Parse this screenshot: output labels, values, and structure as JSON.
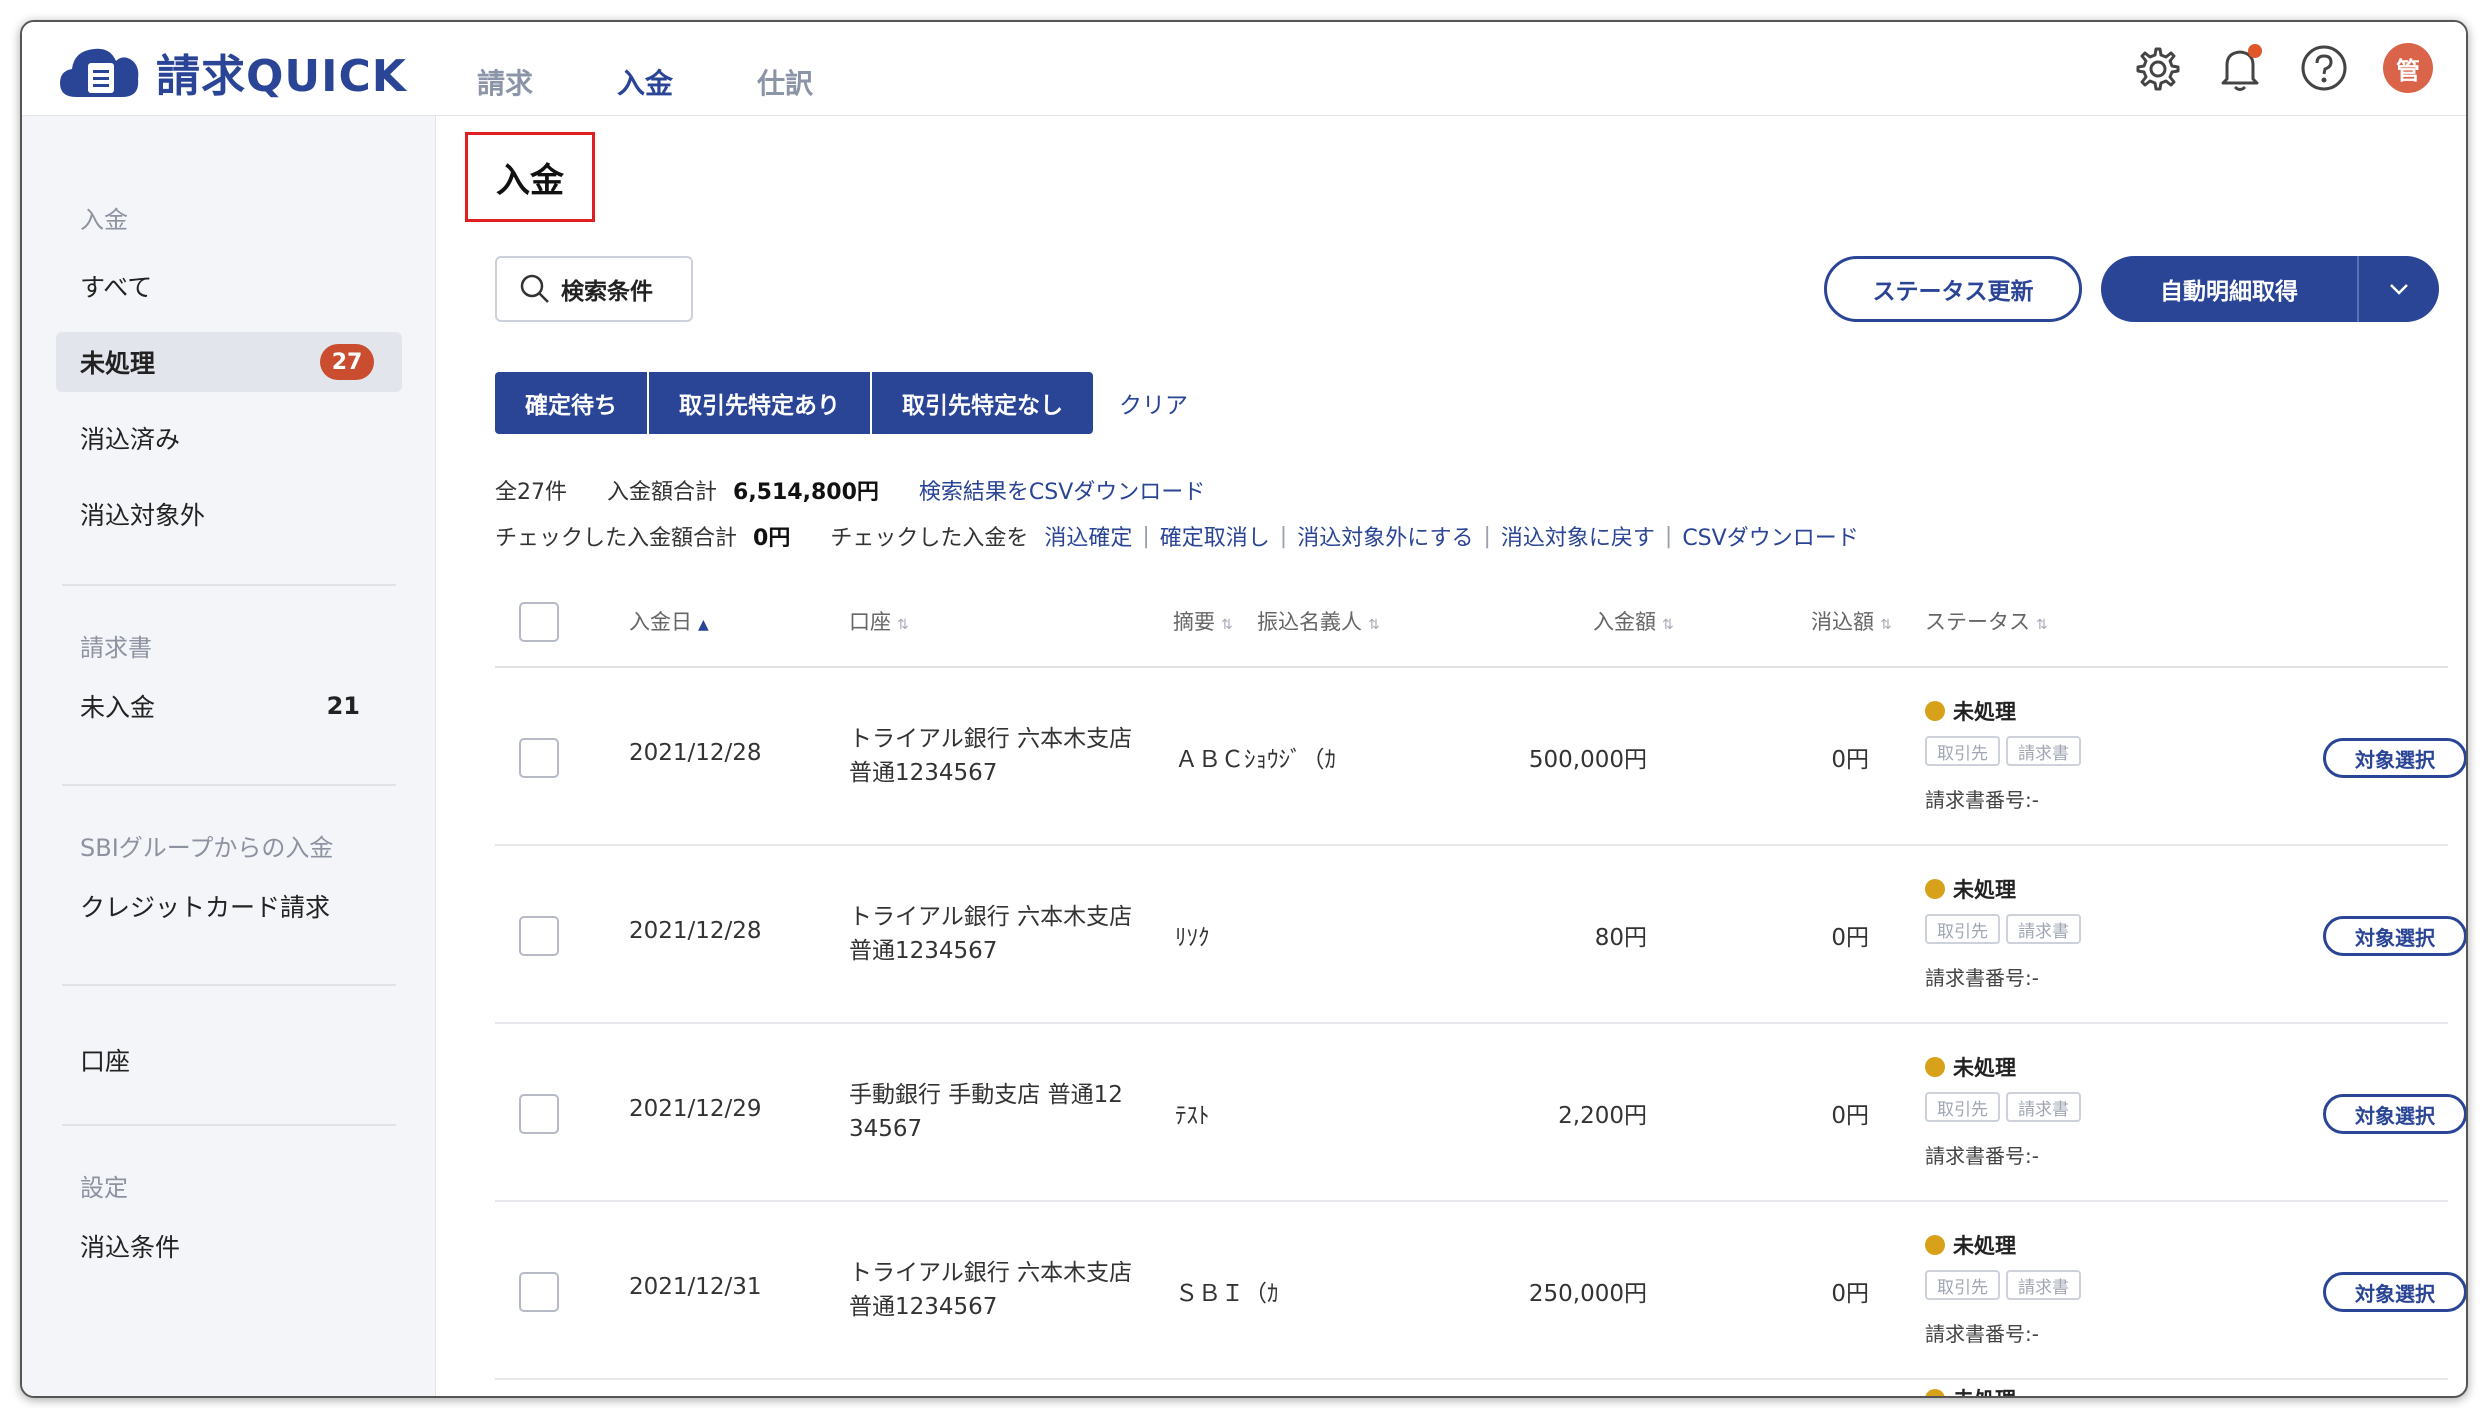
{
  "app": {
    "name": "請求QUICK",
    "avatar_initial": "管",
    "colors": {
      "primary": "#2a4496",
      "badge": "#c94d2e",
      "status_dot": "#d8a11a",
      "highlight_box": "#e02020"
    },
    "icons": [
      "logo-icon",
      "gear-icon",
      "bell-icon",
      "help-icon",
      "avatar"
    ]
  },
  "nav": {
    "items": [
      "請求",
      "入金",
      "仕訳"
    ],
    "active": "入金"
  },
  "sidebar": {
    "sections": [
      {
        "title": "入金",
        "items": [
          {
            "label": "すべて"
          },
          {
            "label": "未処理",
            "badge": "27",
            "active": true
          },
          {
            "label": "消込済み"
          },
          {
            "label": "消込対象外"
          }
        ]
      },
      {
        "title": "請求書",
        "items": [
          {
            "label": "未入金",
            "count": "21"
          }
        ]
      },
      {
        "title": "SBIグループからの入金",
        "items": [
          {
            "label": "クレジットカード請求"
          }
        ]
      },
      {
        "title": "",
        "items": [
          {
            "label": "口座"
          }
        ]
      },
      {
        "title": "設定",
        "items": [
          {
            "label": "消込条件"
          }
        ]
      }
    ]
  },
  "main": {
    "title": "入金",
    "search_label": "検索条件",
    "status_update_label": "ステータス更新",
    "auto_fetch_label": "自動明細取得",
    "filters": [
      "確定待ち",
      "取引先特定あり",
      "取引先特定なし"
    ],
    "clear_label": "クリア",
    "summary": {
      "total_count": "全27件",
      "amount_label": "入金額合計",
      "amount_value": "6,514,800円",
      "csv_link": "検索結果をCSVダウンロード",
      "checked_label": "チェックした入金額合計",
      "checked_value": "0円",
      "checked_action_label": "チェックした入金を",
      "actions": [
        "消込確定",
        "確定取消し",
        "消込対象外にする",
        "消込対象に戻す",
        "CSVダウンロード"
      ]
    },
    "columns": {
      "date": "入金日",
      "account": "口座",
      "memo": "摘要",
      "payer": "振込名義人",
      "amount": "入金額",
      "cleared": "消込額",
      "status": "ステータス"
    },
    "rows": [
      {
        "date": "2021/12/28",
        "account_line1": "トライアル銀行 六本木支店",
        "account_line2": "普通1234567",
        "payer": "ＡＢＣｼｮｳｼﾞ（ｶ",
        "amount": "500,000円",
        "cleared": "0円",
        "status": "未処理",
        "tag1": "取引先",
        "tag2": "請求書",
        "invoice_no": "請求書番号:-",
        "button": "対象選択"
      },
      {
        "date": "2021/12/28",
        "account_line1": "トライアル銀行 六本木支店",
        "account_line2": "普通1234567",
        "payer": "ﾘｿｸ",
        "amount": "80円",
        "cleared": "0円",
        "status": "未処理",
        "tag1": "取引先",
        "tag2": "請求書",
        "invoice_no": "請求書番号:-",
        "button": "対象選択"
      },
      {
        "date": "2021/12/29",
        "account_line1": "手動銀行 手動支店 普通12",
        "account_line2": "34567",
        "payer": "ﾃｽﾄ",
        "amount": "2,200円",
        "cleared": "0円",
        "status": "未処理",
        "tag1": "取引先",
        "tag2": "請求書",
        "invoice_no": "請求書番号:-",
        "button": "対象選択"
      },
      {
        "date": "2021/12/31",
        "account_line1": "トライアル銀行 六本木支店",
        "account_line2": "普通1234567",
        "payer": "ＳＢＩ（ｶ",
        "amount": "250,000円",
        "cleared": "0円",
        "status": "未処理",
        "tag1": "取引先",
        "tag2": "請求書",
        "invoice_no": "請求書番号:-",
        "button": "対象選択"
      }
    ],
    "partial_row_status": "未処理"
  }
}
